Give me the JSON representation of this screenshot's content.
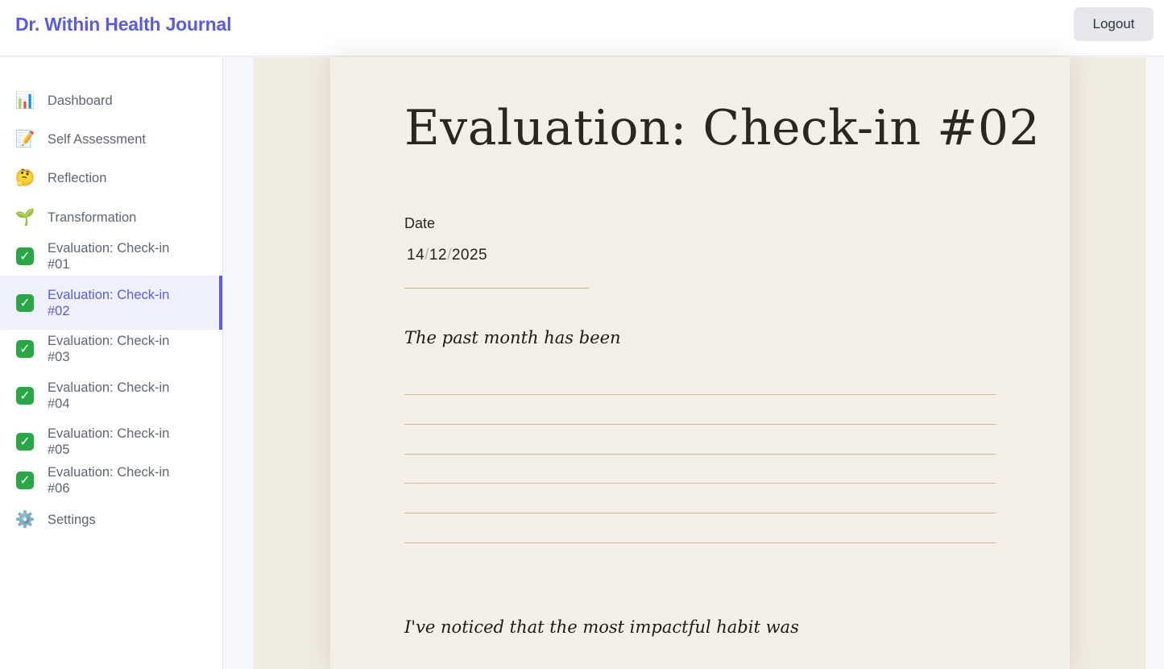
{
  "header": {
    "brand": "Dr. Within Health Journal",
    "logout_label": "Logout"
  },
  "sidebar": {
    "items": [
      {
        "label": "Dashboard",
        "icon": "bar-chart-icon",
        "glyph": "📊"
      },
      {
        "label": "Self Assessment",
        "icon": "memo-icon",
        "glyph": "📝"
      },
      {
        "label": "Reflection",
        "icon": "thinking-face-icon",
        "glyph": "🤔"
      },
      {
        "label": "Transformation",
        "icon": "seedling-icon",
        "glyph": "🌱"
      },
      {
        "label": "Evaluation: Check-in #01",
        "icon": "check-mark-icon",
        "glyph": "✓"
      },
      {
        "label": "Evaluation: Check-in #02",
        "icon": "check-mark-icon",
        "glyph": "✓",
        "active": true
      },
      {
        "label": "Evaluation: Check-in #03",
        "icon": "check-mark-icon",
        "glyph": "✓"
      },
      {
        "label": "Evaluation: Check-in #04",
        "icon": "check-mark-icon",
        "glyph": "✓"
      },
      {
        "label": "Evaluation: Check-in #05",
        "icon": "check-mark-icon",
        "glyph": "✓"
      },
      {
        "label": "Evaluation: Check-in #06",
        "icon": "check-mark-icon",
        "glyph": "✓"
      },
      {
        "label": "Settings",
        "icon": "gear-icon",
        "glyph": "⚙️"
      }
    ]
  },
  "main": {
    "title": "Evaluation: Check-in #02",
    "date": {
      "label": "Date",
      "day": "14",
      "month": "12",
      "year": "2025",
      "separator": "/"
    },
    "prompts": [
      "The past month has been",
      "I've noticed that the most impactful habit was"
    ]
  },
  "colors": {
    "accent": "#5b5ce0",
    "paper": "#f3efe6",
    "rule_line": "#cdbb92",
    "check_green": "#27a844"
  }
}
